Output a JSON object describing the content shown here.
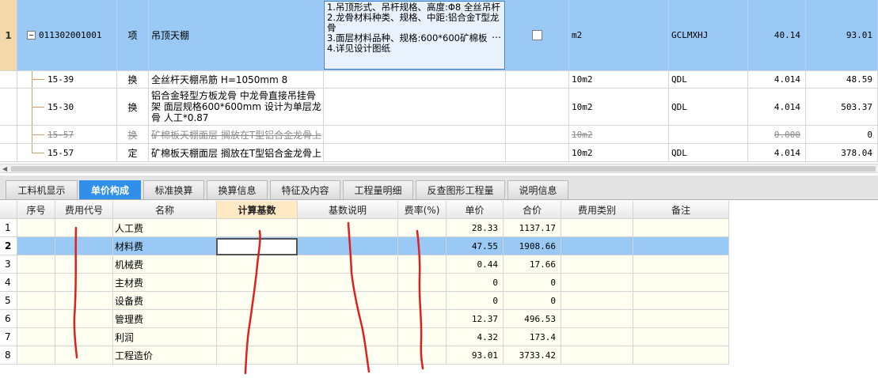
{
  "upper_grid": {
    "rows": [
      {
        "rownum": "1",
        "code": "011302001001",
        "type": "项",
        "name": "吊顶天棚",
        "desc": "1.吊顶形式、吊杆规格、高度:Φ8 全丝吊杆\n2.龙骨材料种类、规格、中距:铝合金T型龙骨\n3.面层材料品种、规格:600*600矿棉板\n4.详见设计图纸",
        "desc_more": "…",
        "unit": "m2",
        "rule": "GCLMXHJ",
        "qty": "40.14",
        "price": "93.01"
      },
      {
        "code": "15-39",
        "type": "换",
        "name": "全丝杆天棚吊筋 H=1050mm 8",
        "unit": "10m2",
        "rule": "QDL",
        "qty": "4.014",
        "price": "48.59"
      },
      {
        "code": "15-30",
        "type": "换",
        "name": "铝合金轻型方板龙骨 中龙骨直接吊挂骨架 面层规格600*600mm  设计为单层龙骨 人工*0.87",
        "unit": "10m2",
        "rule": "QDL",
        "qty": "4.014",
        "price": "503.37"
      },
      {
        "code": "15-57",
        "type": "换",
        "name": "矿棉板天棚面层 搁放在T型铝合金龙骨上",
        "unit": "10m2",
        "rule": "",
        "qty": "0.000",
        "price": "0"
      },
      {
        "code": "15-57",
        "type": "定",
        "name": "矿棉板天棚面层 搁放在T型铝合金龙骨上",
        "unit": "10m2",
        "rule": "QDL",
        "qty": "4.014",
        "price": "378.04"
      }
    ]
  },
  "tabs": [
    "工料机显示",
    "单价构成",
    "标准换算",
    "换算信息",
    "特征及内容",
    "工程量明细",
    "反查图形工程量",
    "说明信息"
  ],
  "active_tab": "单价构成",
  "lower_grid": {
    "headers": [
      "序号",
      "费用代号",
      "名称",
      "计算基数",
      "基数说明",
      "费率(%)",
      "单价",
      "合价",
      "费用类别",
      "备注"
    ],
    "rows": [
      {
        "idx": "1",
        "name": "人工费",
        "unit_price": "28.33",
        "total": "1137.17"
      },
      {
        "idx": "2",
        "name": "材料费",
        "unit_price": "47.55",
        "total": "1908.66"
      },
      {
        "idx": "3",
        "name": "机械费",
        "unit_price": "0.44",
        "total": "17.66"
      },
      {
        "idx": "4",
        "name": "主材费",
        "unit_price": "0",
        "total": "0"
      },
      {
        "idx": "5",
        "name": "设备费",
        "unit_price": "0",
        "total": "0"
      },
      {
        "idx": "6",
        "name": "管理费",
        "unit_price": "12.37",
        "total": "496.53"
      },
      {
        "idx": "7",
        "name": "利润",
        "unit_price": "4.32",
        "total": "173.4"
      },
      {
        "idx": "8",
        "name": "工程造价",
        "unit_price": "93.01",
        "total": "3733.42"
      }
    ]
  },
  "colors": {
    "selected_row": "#99c9f4",
    "active_tab": "#2f8fea",
    "annotation_red": "#e02020"
  }
}
